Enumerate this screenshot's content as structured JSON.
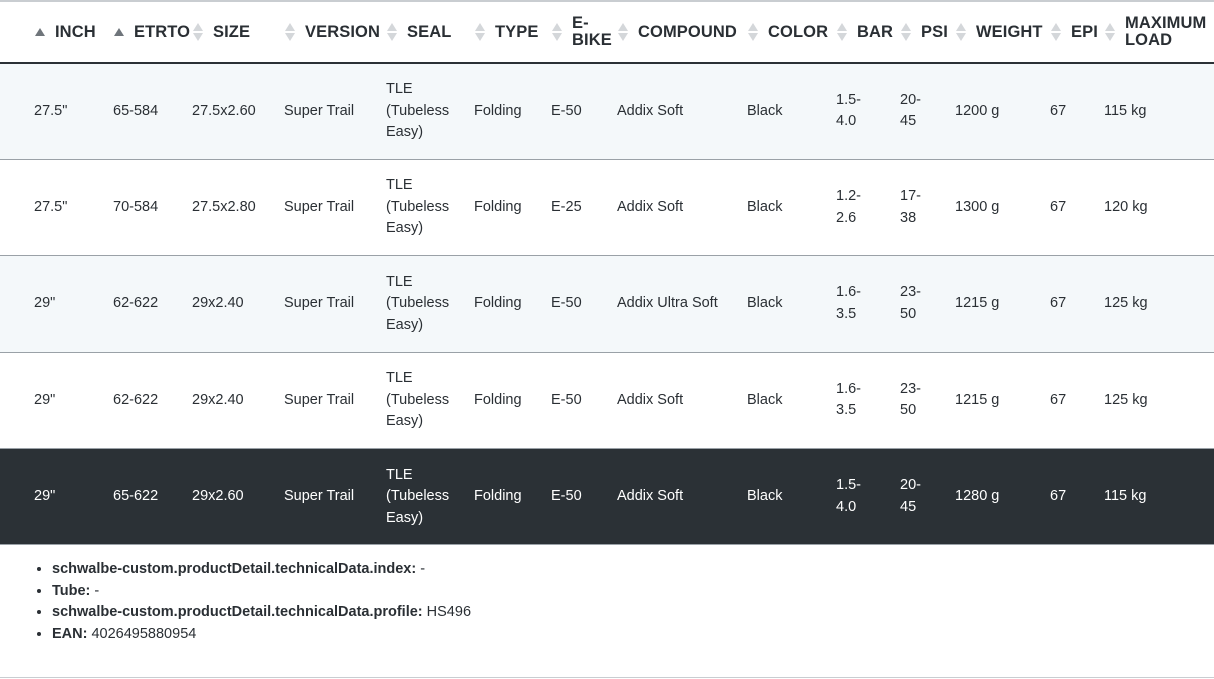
{
  "headers": [
    {
      "key": "inch",
      "label": "INCH",
      "sort": "asc"
    },
    {
      "key": "etrto",
      "label": "ETRTO",
      "sort": "asc"
    },
    {
      "key": "size",
      "label": "SIZE",
      "sort": "none"
    },
    {
      "key": "version",
      "label": "VERSION",
      "sort": "none"
    },
    {
      "key": "seal",
      "label": "SEAL",
      "sort": "none"
    },
    {
      "key": "type",
      "label": "TYPE",
      "sort": "none"
    },
    {
      "key": "ebike",
      "label_line1": "E-",
      "label_line2": "BIKE",
      "sort": "none"
    },
    {
      "key": "compound",
      "label": "COMPOUND",
      "sort": "none"
    },
    {
      "key": "color",
      "label": "COLOR",
      "sort": "none"
    },
    {
      "key": "bar",
      "label": "BAR",
      "sort": "none"
    },
    {
      "key": "psi",
      "label": "PSI",
      "sort": "none"
    },
    {
      "key": "weight",
      "label": "WEIGHT",
      "sort": "none"
    },
    {
      "key": "epi",
      "label": "EPI",
      "sort": "none"
    },
    {
      "key": "max_load",
      "label_line1": "MAXIMUM",
      "label_line2": "LOAD",
      "sort": "none"
    }
  ],
  "rows": [
    {
      "inch": "27.5\"",
      "etrto": "65-584",
      "size": "27.5x2.60",
      "version": "Super Trail",
      "seal": [
        "TLE",
        "(Tubeless",
        "Easy)"
      ],
      "type": "Folding",
      "ebike": "E-50",
      "compound": "Addix Soft",
      "color": "Black",
      "bar": [
        "1.5-",
        "4.0"
      ],
      "psi": [
        "20-",
        "45"
      ],
      "weight": "1200 g",
      "epi": "67",
      "max_load": "115 kg",
      "selected": false
    },
    {
      "inch": "27.5\"",
      "etrto": "70-584",
      "size": "27.5x2.80",
      "version": "Super Trail",
      "seal": [
        "TLE",
        "(Tubeless",
        "Easy)"
      ],
      "type": "Folding",
      "ebike": "E-25",
      "compound": "Addix Soft",
      "color": "Black",
      "bar": [
        "1.2-",
        "2.6"
      ],
      "psi": [
        "17-",
        "38"
      ],
      "weight": "1300 g",
      "epi": "67",
      "max_load": "120 kg",
      "selected": false
    },
    {
      "inch": "29\"",
      "etrto": "62-622",
      "size": "29x2.40",
      "version": "Super Trail",
      "seal": [
        "TLE",
        "(Tubeless",
        "Easy)"
      ],
      "type": "Folding",
      "ebike": "E-50",
      "compound": "Addix Ultra Soft",
      "color": "Black",
      "bar": [
        "1.6-",
        "3.5"
      ],
      "psi": [
        "23-",
        "50"
      ],
      "weight": "1215 g",
      "epi": "67",
      "max_load": "125 kg",
      "selected": false
    },
    {
      "inch": "29\"",
      "etrto": "62-622",
      "size": "29x2.40",
      "version": "Super Trail",
      "seal": [
        "TLE",
        "(Tubeless",
        "Easy)"
      ],
      "type": "Folding",
      "ebike": "E-50",
      "compound": "Addix Soft",
      "color": "Black",
      "bar": [
        "1.6-",
        "3.5"
      ],
      "psi": [
        "23-",
        "50"
      ],
      "weight": "1215 g",
      "epi": "67",
      "max_load": "125 kg",
      "selected": false
    },
    {
      "inch": "29\"",
      "etrto": "65-622",
      "size": "29x2.60",
      "version": "Super Trail",
      "seal": [
        "TLE",
        "(Tubeless",
        "Easy)"
      ],
      "type": "Folding",
      "ebike": "E-50",
      "compound": "Addix Soft",
      "color": "Black",
      "bar": [
        "1.5-",
        "4.0"
      ],
      "psi": [
        "20-",
        "45"
      ],
      "weight": "1280 g",
      "epi": "67",
      "max_load": "115 kg",
      "selected": true
    }
  ],
  "details": [
    {
      "key": "schwalbe-custom.productDetail.technicalData.index:",
      "value": "-"
    },
    {
      "key": "Tube:",
      "value": "-"
    },
    {
      "key": "schwalbe-custom.productDetail.technicalData.profile:",
      "value": "HS496"
    },
    {
      "key": "EAN:",
      "value": "4026495880954"
    }
  ],
  "colors": {
    "selected_row_bg": "#2b3136",
    "alt_row_bg": "#f4f8fa",
    "text": "#2a2f34"
  }
}
